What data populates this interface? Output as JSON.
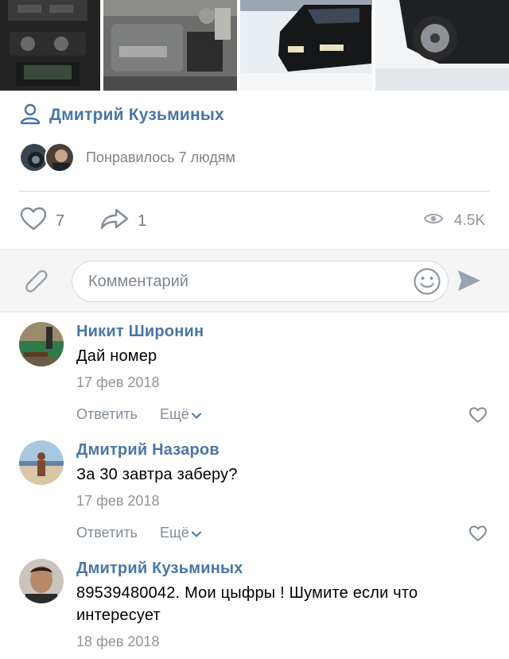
{
  "post": {
    "author": "Дмитрий Кузьминых",
    "liked_by_text": "Понравилось 7 людям",
    "likes": "7",
    "shares": "1",
    "views": "4.5K"
  },
  "composer": {
    "placeholder": "Комментарий"
  },
  "comments": [
    {
      "author": "Никит Широнин",
      "text": "Дай номер",
      "date": "17 фев 2018",
      "reply": "Ответить",
      "more": "Ещё"
    },
    {
      "author": "Дмитрий Назаров",
      "text": "За 30 завтра заберу?",
      "date": "17 фев 2018",
      "reply": "Ответить",
      "more": "Ещё"
    },
    {
      "author": "Дмитрий Кузьминых",
      "text": "89539480042. Мои цыфры ! Шумите если что интересует",
      "date": "18 фев 2018"
    }
  ],
  "colors": {
    "accent": "#4a76a8",
    "secondary": "#818c99"
  },
  "icons": [
    "user-icon",
    "heart-icon",
    "share-icon",
    "eye-icon",
    "paperclip-icon",
    "emoji-icon",
    "send-icon",
    "chevron-down-icon"
  ]
}
